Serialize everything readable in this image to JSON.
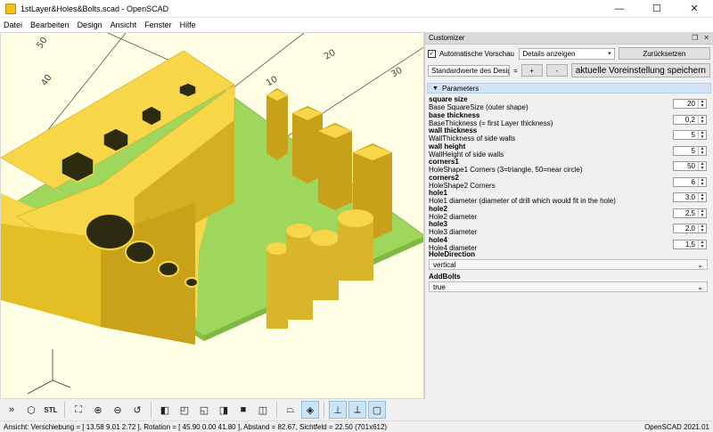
{
  "window": {
    "title": "1stLayer&Holes&Bolts.scad - OpenSCAD",
    "minimize": "—",
    "maximize": "☐",
    "close": "✕"
  },
  "menu": [
    "Datei",
    "Bearbeiten",
    "Design",
    "Ansicht",
    "Fenster",
    "Hilfe"
  ],
  "customizer": {
    "title": "Customizer",
    "auto_preview_label": "Automatische Vorschau",
    "auto_preview_checked": true,
    "details_combo": "Details anzeigen",
    "reset_button": "Zurücksetzen",
    "preset_combo": "Standardwerte des Designs",
    "preset_sep": "=",
    "add_button": "+",
    "remove_button": "-",
    "save_preset_button": "aktuelle Voreinstellung speichern",
    "section_title": "Parameters",
    "params": [
      {
        "name": "square size",
        "desc": "Base SquareSize (outer shape)",
        "value": "20"
      },
      {
        "name": "base thickness",
        "desc": "BaseThickness (= first Layer thickness)",
        "value": "0,2"
      },
      {
        "name": "wall thickness",
        "desc": "WallThickness of side walls",
        "value": "5"
      },
      {
        "name": "wall height",
        "desc": "WallHeight of side walls",
        "value": "5"
      },
      {
        "name": "corners1",
        "desc": "HoleShape1 Corners (3=triangle, 50=near circle)",
        "value": "50"
      },
      {
        "name": "corners2",
        "desc": "HoleShape2 Corners",
        "value": "6"
      },
      {
        "name": "hole1",
        "desc": "Hole1 diameter (diameter of drill which would fit in the hole)",
        "value": "3,0"
      },
      {
        "name": "hole2",
        "desc": "Hole2  diameter",
        "value": "2,5"
      },
      {
        "name": "hole3",
        "desc": "Hole3  diameter",
        "value": "2,0"
      },
      {
        "name": "hole4",
        "desc": "Hole4  diameter",
        "value": "1,5"
      }
    ],
    "hole_direction": {
      "name": "HoleDirection",
      "value": "vertical"
    },
    "add_bolts": {
      "name": "AddBolts",
      "value": "true"
    }
  },
  "viewport": {
    "axis_labels": [
      "10",
      "20",
      "30",
      "40",
      "50"
    ]
  },
  "toolbar": {
    "stl_label": "STL"
  },
  "status": {
    "left": "Ansicht: Verschiebung = [ 13.58 9.01 2.72 ], Rotation = [ 45.90 0.00 41.80 ], Abstand = 82.67, Sichtfeld = 22.50 (701x612)",
    "right": "OpenSCAD 2021.01"
  },
  "colors": {
    "viewport_bg": "#ffffe5",
    "model_yellow": "#f7d748",
    "model_green": "#9fd65c",
    "params_header": "#d4e4f7"
  }
}
